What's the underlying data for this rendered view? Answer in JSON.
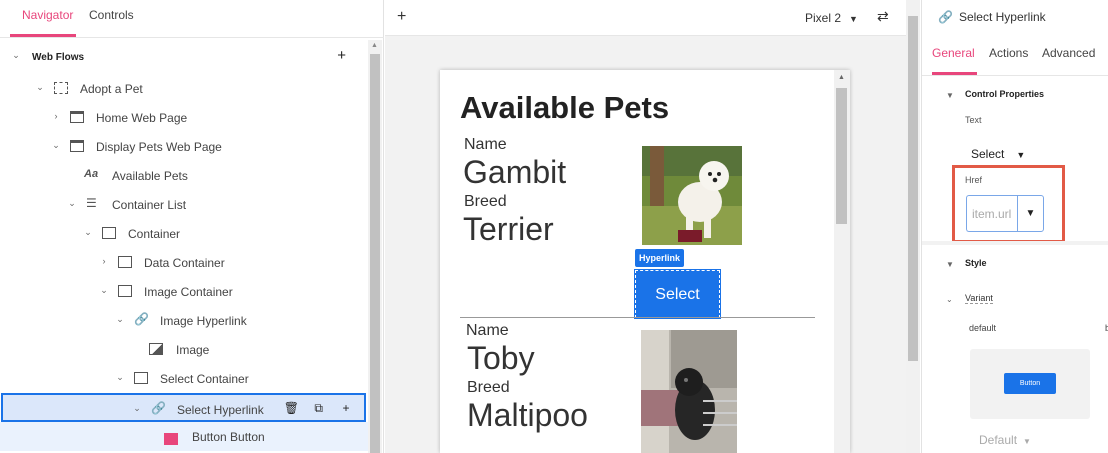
{
  "left_tabs": {
    "navigator": "Navigator",
    "controls": "Controls"
  },
  "tree": {
    "root": "Web Flows",
    "add_icon": "+",
    "items": [
      {
        "label": "Adopt a Pet",
        "icon": "flow-icon"
      },
      {
        "label": "Home Web Page",
        "icon": "page-icon"
      },
      {
        "label": "Display Pets Web Page",
        "icon": "page-icon"
      },
      {
        "label": "Available Pets",
        "icon": "text-icon"
      },
      {
        "label": "Container List",
        "icon": "list-icon"
      },
      {
        "label": "Container",
        "icon": "container-icon"
      },
      {
        "label": "Data Container",
        "icon": "container-icon"
      },
      {
        "label": "Image Container",
        "icon": "container-icon"
      },
      {
        "label": "Image Hyperlink",
        "icon": "link-icon"
      },
      {
        "label": "Image",
        "icon": "image-icon"
      },
      {
        "label": "Select Container",
        "icon": "container-icon"
      },
      {
        "label": "Select Hyperlink",
        "icon": "link-icon"
      },
      {
        "label": "Button Button",
        "icon": "button-icon"
      }
    ],
    "text_icon_glyph": "Aa",
    "row_actions": {
      "delete": "🗑",
      "copy": "⧉",
      "add": "+"
    }
  },
  "canvas": {
    "add": "+",
    "device": "Pixel 2",
    "rotate": "⇄"
  },
  "preview": {
    "title": "Available Pets",
    "pets": [
      {
        "name_label": "Name",
        "name": "Gambit",
        "breed_label": "Breed",
        "breed": "Terrier"
      },
      {
        "name_label": "Name",
        "name": "Toby",
        "breed_label": "Breed",
        "breed": "Maltipoo"
      }
    ],
    "hyperlink_tag": "Hyperlink",
    "select_button": "Select"
  },
  "properties": {
    "title": "Select Hyperlink",
    "tabs": {
      "general": "General",
      "actions": "Actions",
      "advanced": "Advanced"
    },
    "control_properties": "Control Properties",
    "text_label": "Text",
    "text_value": "Select",
    "href_label": "Href",
    "href_placeholder": "item.url",
    "style": "Style",
    "variant": "Variant",
    "variant_default": "default",
    "variant_second_truncated": "b",
    "preview_button": "Button",
    "bottom_default": "Default"
  },
  "colors": {
    "accent_pink": "#e8467c",
    "primary_blue": "#1a73e8",
    "highlight_red": "#e25a46"
  }
}
